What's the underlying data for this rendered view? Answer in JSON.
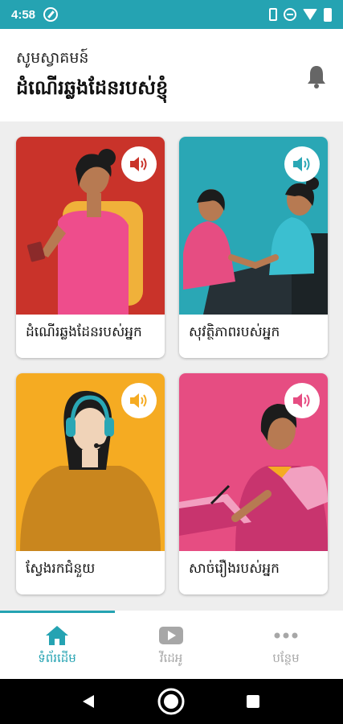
{
  "status_bar": {
    "time": "4:58"
  },
  "header": {
    "greeting": "សូមស្វាគមន៍",
    "title": "ដំណើរឆ្លងដែនរបស់ខ្ញុំ"
  },
  "cards": [
    {
      "label": "ដំណើរឆ្លងដែនរបស់អ្នក",
      "bg": "#c9332a"
    },
    {
      "label": "សុវត្ថិភាពរបស់អ្នក",
      "bg": "#2aa7b5"
    },
    {
      "label": "ស្វែងរកជំនួយ",
      "bg": "#f5ab22"
    },
    {
      "label": "សាច់រឿងរបស់អ្នក",
      "bg": "#e64d82"
    }
  ],
  "bottom_nav": [
    {
      "label": "ទំព័រដើម",
      "active": true
    },
    {
      "label": "វីដេអូ",
      "active": false
    },
    {
      "label": "បន្ថែម",
      "active": false
    }
  ],
  "colors": {
    "accent": "#25a3b2",
    "inactive": "#a7a7a7"
  }
}
